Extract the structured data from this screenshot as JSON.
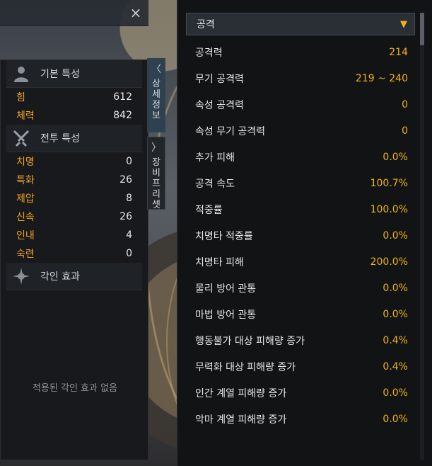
{
  "window": {
    "close_label": "×"
  },
  "left": {
    "basic": {
      "title": "기본 특성",
      "icon": "person-icon",
      "stats": [
        {
          "label": "힘",
          "value": "612"
        },
        {
          "label": "체력",
          "value": "842"
        }
      ]
    },
    "combat": {
      "title": "전투 특성",
      "icon": "crossed-swords-icon",
      "stats": [
        {
          "label": "치명",
          "value": "0"
        },
        {
          "label": "특화",
          "value": "26"
        },
        {
          "label": "제압",
          "value": "8"
        },
        {
          "label": "신속",
          "value": "26"
        },
        {
          "label": "인내",
          "value": "4"
        },
        {
          "label": "숙련",
          "value": "0"
        }
      ]
    },
    "engraving": {
      "title": "각인 효과",
      "icon": "compass-star-icon",
      "empty_text": "적용된 각인 효과 없음"
    }
  },
  "tabs": {
    "detail": {
      "chevron": "〈",
      "label": "상세정보"
    },
    "preset": {
      "chevron": "〉",
      "label": "장비프리셋"
    }
  },
  "right": {
    "dropdown": {
      "label": "공격",
      "arrow": "▼"
    },
    "rows": [
      {
        "label": "공격력",
        "value": "214"
      },
      {
        "label": "무기 공격력",
        "value": "219 ~ 240"
      },
      {
        "label": "속성 공격력",
        "value": "0"
      },
      {
        "label": "속성 무기 공격력",
        "value": "0"
      },
      {
        "label": "추가 피해",
        "value": "0.0%"
      },
      {
        "label": "공격 속도",
        "value": "100.7%"
      },
      {
        "label": "적중률",
        "value": "100.0%"
      },
      {
        "label": "치명타 적중률",
        "value": "0.0%"
      },
      {
        "label": "치명타 피해",
        "value": "200.0%"
      },
      {
        "label": "물리 방어 관통",
        "value": "0.0%"
      },
      {
        "label": "마법 방어 관통",
        "value": "0.0%"
      },
      {
        "label": "행동불가 대상 피해량 증가",
        "value": "0.4%"
      },
      {
        "label": "무력화 대상 피해량 증가",
        "value": "0.4%"
      },
      {
        "label": "인간 계열 피해량 증가",
        "value": "0.0%"
      },
      {
        "label": "악마 계열 피해량 증가",
        "value": "0.0%"
      }
    ]
  },
  "colors": {
    "accent": "#f0b419",
    "stat_label": "#f2a31f"
  }
}
